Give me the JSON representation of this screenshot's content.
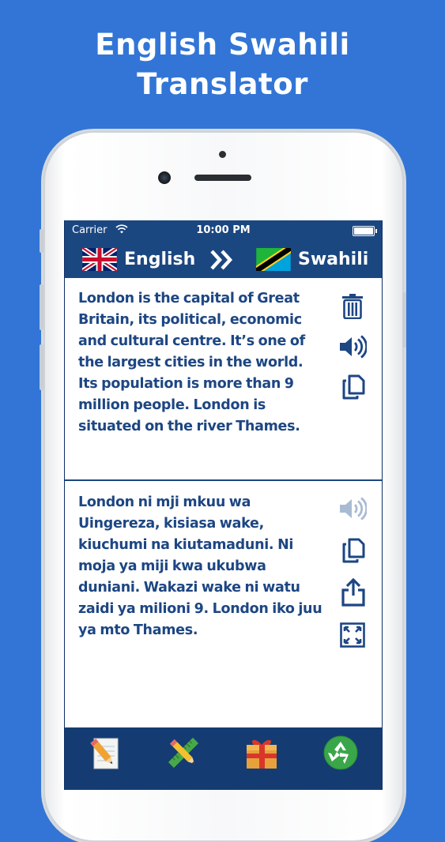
{
  "promo": {
    "title_line1": "English Swahili",
    "title_line2": "Translator"
  },
  "status_bar": {
    "carrier": "Carrier",
    "time": "10:00 PM"
  },
  "language_bar": {
    "source_language": "English",
    "target_language": "Swahili",
    "source_flag": "uk-flag-icon",
    "target_flag": "tanzania-flag-icon",
    "swap_icon": "double-chevron-right-icon"
  },
  "input_pane": {
    "text": "London is the capital of Great Britain, its political, economic and cultural centre. It’s one of the largest cities in the world. Its population is more than 9 million people. London is situated on the river Thames.",
    "actions": [
      "trash-icon",
      "speaker-icon",
      "copy-icon"
    ]
  },
  "output_pane": {
    "text": "London ni mji mkuu wa Uingereza, kisiasa wake, kiuchumi na kiutamaduni. Ni moja ya miji kwa ukubwa duniani. Wakazi wake ni watu zaidi ya milioni 9. London iko juu ya mto Thames.",
    "actions": [
      "speaker-icon-disabled",
      "copy-icon",
      "share-icon",
      "fullscreen-icon"
    ]
  },
  "tab_bar": {
    "items": [
      "notepad-pencil-icon",
      "pencil-ruler-icon",
      "gift-icon",
      "recycle-icon"
    ]
  },
  "colors": {
    "background": "#3275d6",
    "header": "#1b4781",
    "text": "#1d4683",
    "tab_bar": "#143c73"
  }
}
